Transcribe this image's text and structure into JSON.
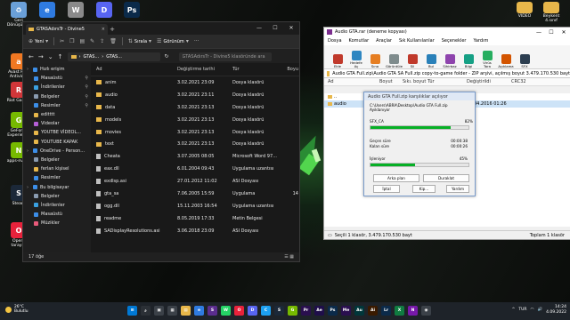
{
  "desktop": {
    "icons": [
      {
        "label": "Geri Dönüşüm...",
        "color": "#6aa0d8",
        "glyph": "♻"
      },
      {
        "label": "",
        "color": "#2f7be0",
        "glyph": "e"
      },
      {
        "label": "",
        "color": "#8a8a8a",
        "glyph": "W"
      },
      {
        "label": "",
        "color": "#5865f2",
        "glyph": "D"
      },
      {
        "label": "",
        "color": "#0b2a4a",
        "glyph": "Ps"
      },
      {
        "label": "Avast Free Antivirus",
        "color": "#f07822",
        "glyph": "a"
      },
      {
        "label": "Riot Games",
        "color": "#d13639",
        "glyph": "R"
      },
      {
        "label": "GeForce Experience",
        "color": "#76b900",
        "glyph": "G"
      },
      {
        "label": "apps-nvidia",
        "color": "#76b900",
        "glyph": "N"
      },
      {
        "label": "Steam",
        "color": "#1b2838",
        "glyph": "S"
      },
      {
        "label": "Opera tarayıcı",
        "color": "#e8223b",
        "glyph": "O"
      }
    ],
    "right_icons": [
      {
        "label": "VIDEO",
        "color": "#e8b74a"
      },
      {
        "label": "Beykent 4.sınıf",
        "color": "#e8b74a"
      }
    ]
  },
  "explorer": {
    "tab_title": "GTASAdırsTr - Divine5",
    "toolbar": {
      "new": "Yeni",
      "sort": "Sırala",
      "view": "Görünüm"
    },
    "address": [
      "GTAS...",
      "GTAS..."
    ],
    "search_placeholder": "GTASAdırsTr - Divine5 klasöründe ara",
    "columns": {
      "name": "Ad",
      "date": "Değiştirme tarihi",
      "type": "Tür",
      "size": "Boyu"
    },
    "sidebar": [
      {
        "label": "Hızlı erişim",
        "level": 0,
        "color": "#3c8ee8",
        "pin": false
      },
      {
        "label": "Masaüstü",
        "level": 1,
        "color": "#3c8ee8",
        "pin": true
      },
      {
        "label": "İndirilenler",
        "level": 1,
        "color": "#3aa0e0",
        "pin": true
      },
      {
        "label": "Belgeler",
        "level": 1,
        "color": "#8a9bb0",
        "pin": true
      },
      {
        "label": "Resimler",
        "level": 1,
        "color": "#3c8ee8",
        "pin": true
      },
      {
        "label": "editttt",
        "level": 1,
        "color": "#e8b74a",
        "pin": false
      },
      {
        "label": "Videolar",
        "level": 1,
        "color": "#b45fd6",
        "pin": false
      },
      {
        "label": "YOUTBE VİDEOL...",
        "level": 1,
        "color": "#e8b74a",
        "pin": false
      },
      {
        "label": "YOUTUBE KAPAK",
        "level": 1,
        "color": "#e8b74a",
        "pin": false
      },
      {
        "label": "OneDrive - Person...",
        "level": 0,
        "color": "#3c8ee8",
        "pin": false
      },
      {
        "label": "Belgeler",
        "level": 1,
        "color": "#8a9bb0",
        "pin": false
      },
      {
        "label": "ferlan kişisel",
        "level": 1,
        "color": "#e8b74a",
        "pin": false
      },
      {
        "label": "Resimler",
        "level": 1,
        "color": "#3c8ee8",
        "pin": false
      },
      {
        "label": "Bu bilgisayar",
        "level": 0,
        "color": "#3c8ee8",
        "pin": false
      },
      {
        "label": "Belgeler",
        "level": 1,
        "color": "#8a9bb0",
        "pin": false
      },
      {
        "label": "İndirilenler",
        "level": 1,
        "color": "#3aa0e0",
        "pin": false
      },
      {
        "label": "Masaüstü",
        "level": 1,
        "color": "#3c8ee8",
        "pin": false
      },
      {
        "label": "Müzikler",
        "level": 1,
        "color": "#e85a7a",
        "pin": false
      }
    ],
    "files": [
      {
        "name": "anim",
        "date": "3.02.2021 23:09",
        "type": "Dosya klasörü",
        "size": "",
        "kind": "folder"
      },
      {
        "name": "audio",
        "date": "3.02.2021 23:11",
        "type": "Dosya klasörü",
        "size": "",
        "kind": "folder"
      },
      {
        "name": "data",
        "date": "3.02.2021 23:13",
        "type": "Dosya klasörü",
        "size": "",
        "kind": "folder"
      },
      {
        "name": "models",
        "date": "3.02.2021 23:13",
        "type": "Dosya klasörü",
        "size": "",
        "kind": "folder"
      },
      {
        "name": "movies",
        "date": "3.02.2021 23:13",
        "type": "Dosya klasörü",
        "size": "",
        "kind": "folder"
      },
      {
        "name": "text",
        "date": "3.02.2021 23:13",
        "type": "Dosya klasörü",
        "size": "",
        "kind": "folder"
      },
      {
        "name": "Cheata",
        "date": "3.07.2005 08:05",
        "type": "Microsoft Word 97...",
        "size": "",
        "kind": "file"
      },
      {
        "name": "eax.dll",
        "date": "6.01.2004 09:43",
        "type": "Uygulama uzantısı",
        "size": "",
        "kind": "file"
      },
      {
        "name": "exdlsp.asi",
        "date": "27.01.2012 11:02",
        "type": "ASI Dosyası",
        "size": "",
        "kind": "file"
      },
      {
        "name": "gta_sa",
        "date": "7.06.2005 15:59",
        "type": "Uygulama",
        "size": "14",
        "kind": "file"
      },
      {
        "name": "ogg.dll",
        "date": "15.11.2003 16:54",
        "type": "Uygulama uzantısı",
        "size": "",
        "kind": "file"
      },
      {
        "name": "readme",
        "date": "8.05.2019 17:33",
        "type": "Metin Belgesi",
        "size": "",
        "kind": "file"
      },
      {
        "name": "SADisplayResolutions.asi",
        "date": "3.06.2018 23:09",
        "type": "ASI Dosyası",
        "size": "",
        "kind": "file"
      }
    ],
    "status": "17 öğe"
  },
  "winrar": {
    "title": "Audio GTA.rar (deneme kopyası)",
    "menu": [
      "Dosya",
      "Komutlar",
      "Araçlar",
      "Sık Kullanılanlar",
      "Seçenekler",
      "Yardım"
    ],
    "tools": [
      {
        "label": "Ekle",
        "color": "#c0392b"
      },
      {
        "label": "Hedefe Aç",
        "color": "#2e86c1"
      },
      {
        "label": "Sına",
        "color": "#e67e22"
      },
      {
        "label": "Görüntüle",
        "color": "#7f8c8d"
      },
      {
        "label": "Sil",
        "color": "#c0392b"
      },
      {
        "label": "Bul",
        "color": "#2980b9"
      },
      {
        "label": "Sihirbaz",
        "color": "#8e44ad"
      },
      {
        "label": "Bilgi",
        "color": "#16a085"
      },
      {
        "label": "Virüs Tara",
        "color": "#27ae60"
      },
      {
        "label": "Açıklama",
        "color": "#d35400"
      },
      {
        "label": "SFX",
        "color": "#2c3e50"
      }
    ],
    "path": "Audio GTA Full.zip\\Audio GTA SA Full.zip copy-to-game folder - ZIP arşivi, açılmış boyut 3.479.170.530 bayt",
    "columns": {
      "name": "Ad",
      "size": "Boyut",
      "packed": "Sıkı. boyut",
      "type": "Tür",
      "modified": "Değiştirildi",
      "crc": "CRC32"
    },
    "rows": [
      {
        "name": "..",
        "size": "",
        "packed": "",
        "type": "Dosya klasörü",
        "modified": "",
        "crc": ""
      },
      {
        "name": "audio",
        "size": "",
        "packed": "",
        "type": "Dosya klasörü",
        "modified": "17.04.2016 01:26",
        "crc": ""
      }
    ],
    "status_left": "Seçili 1 klasör, 3.479.170.530 bayt",
    "status_right": "Toplam 1 klasör"
  },
  "progress_dialog": {
    "title": "Audio GTA Full.zip karşılıklar açılıyor",
    "path": "C:\\Users\\ABRA\\Desktop\\Audio GTA Full.zip",
    "action": "Ayıklanıyor",
    "file": "SFX_CA",
    "file_percent_label": "82%",
    "file_progress": 0.82,
    "elapsed_label": "Geçen süre",
    "elapsed": "00:00:38",
    "remaining_label": "Kalan süre",
    "remaining": "00:00:26",
    "overall_label": "İşleniyor",
    "overall_percent_label": "45%",
    "overall_progress": 0.45,
    "buttons": {
      "background": "Arka plan",
      "pause": "Duraklat",
      "cancel": "İptal",
      "mode": "Kip...",
      "help": "Yardım"
    }
  },
  "taskbar": {
    "temp": "26°C",
    "weather": "Bulutlu",
    "apps": [
      {
        "glyph": "⊞",
        "color": "#0078d4"
      },
      {
        "glyph": "⌕",
        "color": "#2b3036"
      },
      {
        "glyph": "▣",
        "color": "#3b4148"
      },
      {
        "glyph": "▦",
        "color": "#3b4148"
      },
      {
        "glyph": "▤",
        "color": "#e8b74a"
      },
      {
        "glyph": "e",
        "color": "#2f7be0"
      },
      {
        "glyph": "S",
        "color": "#5b2d8e"
      },
      {
        "glyph": "W",
        "color": "#25d366"
      },
      {
        "glyph": "O",
        "color": "#e8223b"
      },
      {
        "glyph": "D",
        "color": "#5865f2"
      },
      {
        "glyph": "C",
        "color": "#1da1f2"
      },
      {
        "glyph": "S",
        "color": "#1b2838"
      },
      {
        "glyph": "G",
        "color": "#76b900"
      },
      {
        "glyph": "Pr",
        "color": "#2a0f4f"
      },
      {
        "glyph": "Ae",
        "color": "#1f0e4a"
      },
      {
        "glyph": "Ps",
        "color": "#0b2a4a"
      },
      {
        "glyph": "Me",
        "color": "#2a0f4f"
      },
      {
        "glyph": "Au",
        "color": "#00363a"
      },
      {
        "glyph": "Ai",
        "color": "#3a1a00"
      },
      {
        "glyph": "Lr",
        "color": "#0b2a4a"
      },
      {
        "glyph": "X",
        "color": "#107c41"
      },
      {
        "glyph": "N",
        "color": "#7719aa"
      },
      {
        "glyph": "◉",
        "color": "#3b4148"
      }
    ],
    "lang": "TUR",
    "time": "14:24",
    "date": "4.09.2022"
  }
}
